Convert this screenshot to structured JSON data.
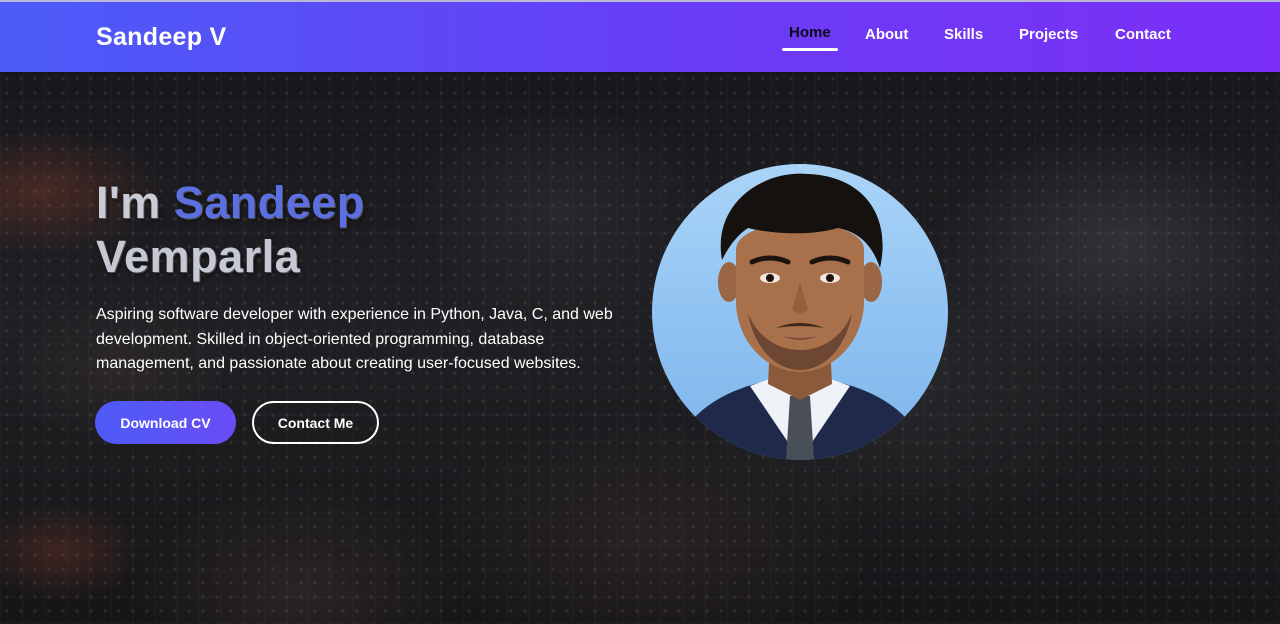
{
  "navbar": {
    "brand": "Sandeep V",
    "links": [
      {
        "label": "Home",
        "active": true
      },
      {
        "label": "About",
        "active": false
      },
      {
        "label": "Skills",
        "active": false
      },
      {
        "label": "Projects",
        "active": false
      },
      {
        "label": "Contact",
        "active": false
      }
    ]
  },
  "hero": {
    "title_prefix": "I'm ",
    "title_name": "Sandeep",
    "title_surname": "Vemparla",
    "description": "Aspiring software developer with experience in Python, Java, C, and web development. Skilled in object-oriented programming, database management, and passionate about creating user-focused websites.",
    "buttons": {
      "download": "Download CV",
      "contact": "Contact Me"
    }
  },
  "colors": {
    "nav_gradient_start": "#4b5cf8",
    "nav_gradient_end": "#7b2ff7",
    "accent": "#5b6fe0",
    "button_primary": "#4d5bf8"
  }
}
